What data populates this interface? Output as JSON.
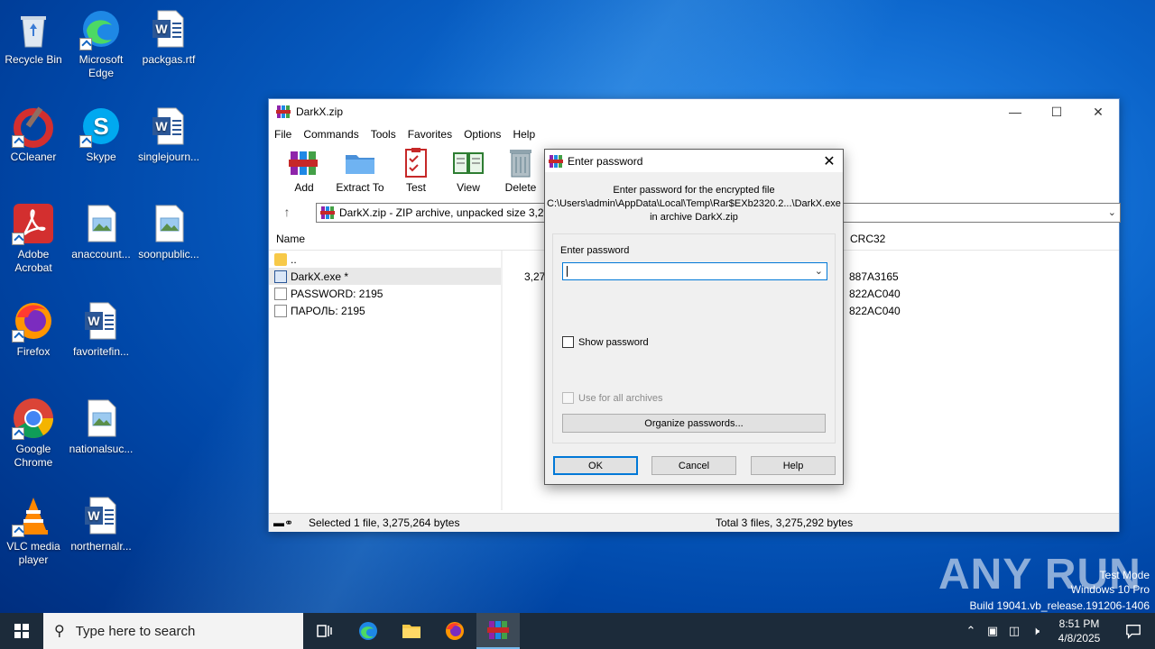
{
  "desktop": {
    "icons": [
      {
        "label": "Recycle Bin",
        "icon": "recycle-bin-icon"
      },
      {
        "label": "Microsoft Edge",
        "icon": "edge-icon"
      },
      {
        "label": "packgas.rtf",
        "icon": "word-doc-icon"
      },
      {
        "label": "CCleaner",
        "icon": "ccleaner-icon"
      },
      {
        "label": "Skype",
        "icon": "skype-icon"
      },
      {
        "label": "singlejourn...",
        "icon": "word-doc-icon"
      },
      {
        "label": "Adobe Acrobat",
        "icon": "acrobat-icon"
      },
      {
        "label": "anaccount...",
        "icon": "image-file-icon"
      },
      {
        "label": "soonpublic...",
        "icon": "image-file-icon"
      },
      {
        "label": "Firefox",
        "icon": "firefox-icon"
      },
      {
        "label": "favoritefin...",
        "icon": "word-doc-icon"
      },
      {
        "label": "Google Chrome",
        "icon": "chrome-icon"
      },
      {
        "label": "nationalsuc...",
        "icon": "image-file-icon"
      },
      {
        "label": "VLC media player",
        "icon": "vlc-icon"
      },
      {
        "label": "northernalr...",
        "icon": "word-doc-icon"
      }
    ]
  },
  "winrar": {
    "title": "DarkX.zip",
    "menu": [
      "File",
      "Commands",
      "Tools",
      "Favorites",
      "Options",
      "Help"
    ],
    "toolbar": [
      {
        "label": "Add",
        "icon": "add-archive-icon"
      },
      {
        "label": "Extract To",
        "icon": "extract-folder-icon"
      },
      {
        "label": "Test",
        "icon": "test-clipboard-icon"
      },
      {
        "label": "View",
        "icon": "view-book-icon"
      },
      {
        "label": "Delete",
        "icon": "trash-icon"
      }
    ],
    "address": "DarkX.zip - ZIP archive, unpacked size 3,275",
    "columns": {
      "name": "Name",
      "crc": "CRC32"
    },
    "files": [
      {
        "name": "..",
        "size": "",
        "crc": "",
        "type": "folder"
      },
      {
        "name": "DarkX.exe *",
        "size": "3,275",
        "crc": "887A3165",
        "type": "exe"
      },
      {
        "name": "PASSWORD: 2195",
        "size": "",
        "crc": "822AC040",
        "type": "file"
      },
      {
        "name": "ПАРОЛЬ: 2195",
        "size": "",
        "crc": "822AC040",
        "type": "file"
      }
    ],
    "status_left": "Selected 1 file, 3,275,264 bytes",
    "status_right": "Total 3 files, 3,275,292 bytes"
  },
  "dialog": {
    "title": "Enter password",
    "line1": "Enter password for the encrypted file",
    "line2": "C:\\Users\\admin\\AppData\\Local\\Temp\\Rar$EXb2320.2...\\DarkX.exe",
    "line3": "in archive DarkX.zip",
    "enter_password_label": "Enter password",
    "password_value": "",
    "show_password": "Show password",
    "use_all": "Use for all archives",
    "organize": "Organize passwords...",
    "ok": "OK",
    "cancel": "Cancel",
    "help": "Help"
  },
  "watermark": {
    "brand": "ANY RUN",
    "test_mode": "Test Mode",
    "os": "Windows 10 Pro",
    "build": "Build 19041.vb_release.191206-1406"
  },
  "taskbar": {
    "search_placeholder": "Type here to search",
    "time": "8:51 PM",
    "date": "4/8/2025"
  },
  "colors": {
    "accent": "#0078d7",
    "taskbar": "#1c2b3a"
  }
}
